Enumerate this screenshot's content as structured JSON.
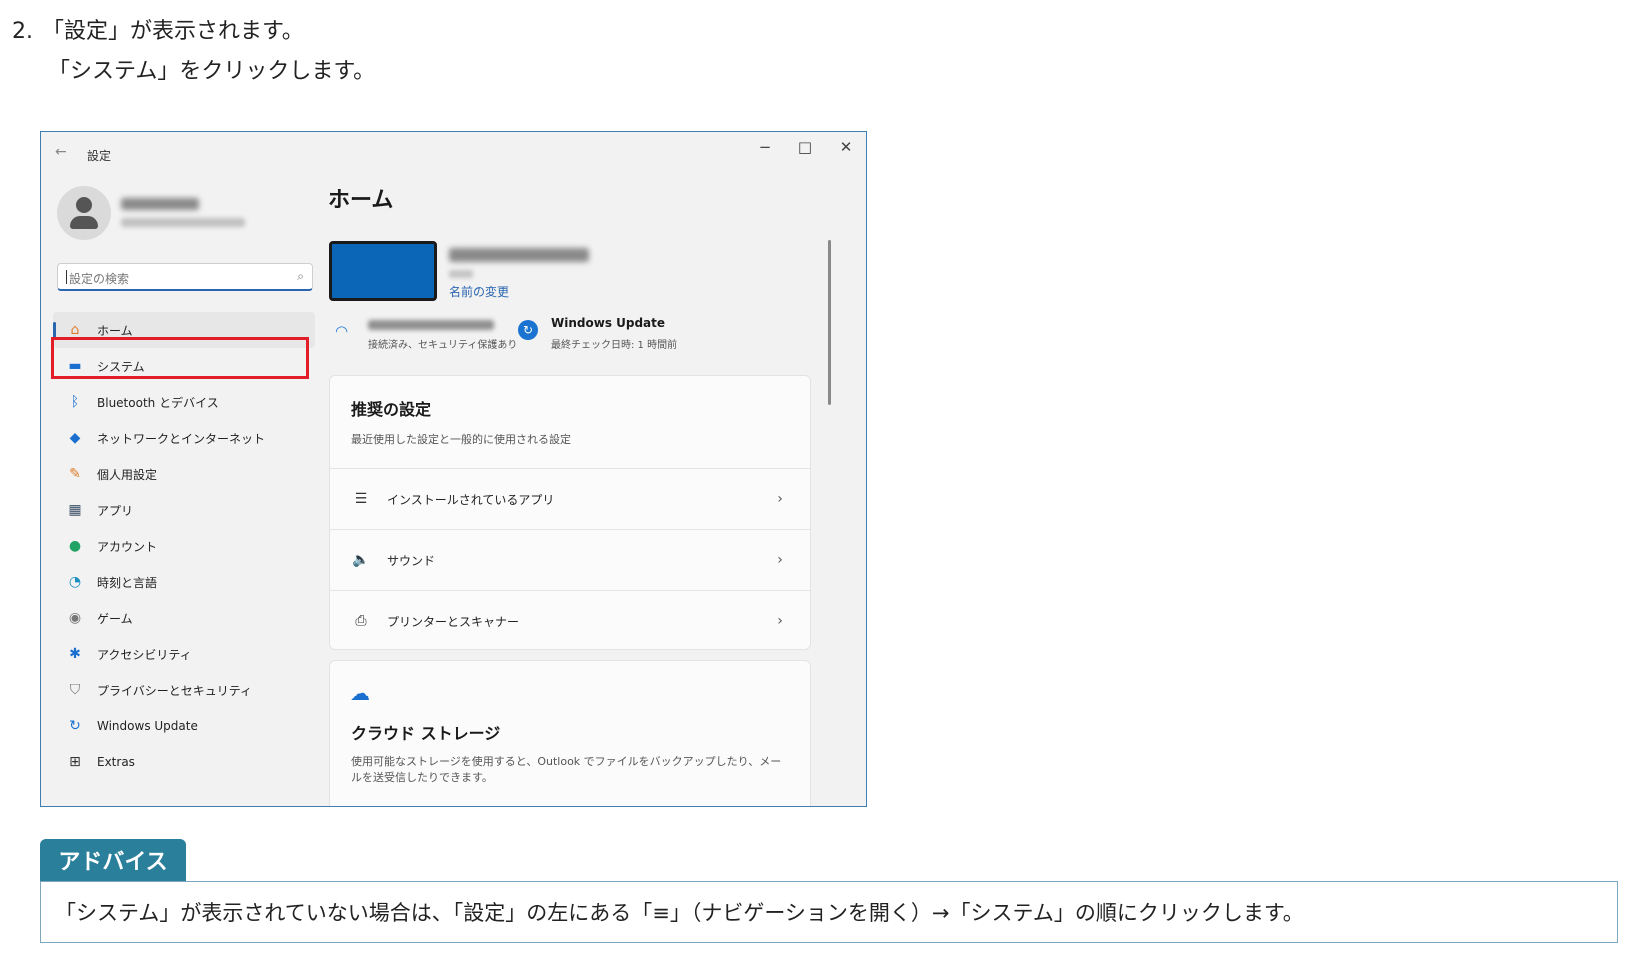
{
  "instructions": {
    "step_number": "2.",
    "line1": "「設定」が表示されます。",
    "line2": "「システム」をクリックします。"
  },
  "window": {
    "back_icon": "←",
    "title": "設定",
    "controls": {
      "minimize": "−",
      "maximize": "□",
      "close": "✕"
    }
  },
  "sidebar": {
    "search_placeholder": "設定の検索",
    "search_icon": "⌕",
    "items": [
      {
        "label": "ホーム",
        "icon": "home-icon",
        "glyph": "⌂",
        "color": "#e07b2a",
        "active": true
      },
      {
        "label": "システム",
        "icon": "display-icon",
        "glyph": "▬",
        "color": "#1a6fcf",
        "active": false
      },
      {
        "label": "Bluetooth とデバイス",
        "icon": "bluetooth-icon",
        "glyph": "ᛒ",
        "color": "#1a6fcf",
        "active": false
      },
      {
        "label": "ネットワークとインターネット",
        "icon": "network-icon",
        "glyph": "◆",
        "color": "#1a6fcf",
        "active": false
      },
      {
        "label": "個人用設定",
        "icon": "brush-icon",
        "glyph": "✎",
        "color": "#e07b2a",
        "active": false
      },
      {
        "label": "アプリ",
        "icon": "apps-icon",
        "glyph": "▦",
        "color": "#3b5068",
        "active": false
      },
      {
        "label": "アカウント",
        "icon": "account-icon",
        "glyph": "●",
        "color": "#21a366",
        "active": false
      },
      {
        "label": "時刻と言語",
        "icon": "globe-clock-icon",
        "glyph": "◔",
        "color": "#1a8fbf",
        "active": false
      },
      {
        "label": "ゲーム",
        "icon": "gamepad-icon",
        "glyph": "◉",
        "color": "#777777",
        "active": false
      },
      {
        "label": "アクセシビリティ",
        "icon": "accessibility-icon",
        "glyph": "✱",
        "color": "#1a6fcf",
        "active": false
      },
      {
        "label": "プライバシーとセキュリティ",
        "icon": "shield-icon",
        "glyph": "⛉",
        "color": "#777777",
        "active": false
      },
      {
        "label": "Windows Update",
        "icon": "windows-update-icon",
        "glyph": "↻",
        "color": "#1a6fcf",
        "active": false
      },
      {
        "label": "Extras",
        "icon": "extras-icon",
        "glyph": "⊞",
        "color": "#333333",
        "active": false
      }
    ]
  },
  "main": {
    "title": "ホーム",
    "rename_link": "名前の変更",
    "wifi_status": "接続済み、セキュリティ保護あり",
    "update": {
      "title": "Windows Update",
      "subtitle": "最終チェック日時: 1 時間前"
    },
    "recommended": {
      "title": "推奨の設定",
      "subtitle": "最近使用した設定と一般的に使用される設定",
      "rows": [
        {
          "label": "インストールされているアプリ",
          "icon": "list-icon",
          "glyph": "☰"
        },
        {
          "label": "サウンド",
          "icon": "speaker-icon",
          "glyph": "🔈"
        },
        {
          "label": "プリンターとスキャナー",
          "icon": "printer-icon",
          "glyph": "⎙"
        }
      ]
    },
    "cloud": {
      "title": "クラウド ストレージ",
      "subtitle": "使用可能なストレージを使用すると、Outlook でファイルをバックアップしたり、メールを送受信したりできます。"
    }
  },
  "advice": {
    "tab_label": "アドバイス",
    "text": "「システム」が表示されていない場合は、「設定」の左にある「≡」（ナビゲーションを開く）→「システム」の順にクリックします。"
  },
  "colors": {
    "accent": "#2a65b0",
    "highlight": "#e11d2a",
    "advice": "#2a7f9a"
  }
}
